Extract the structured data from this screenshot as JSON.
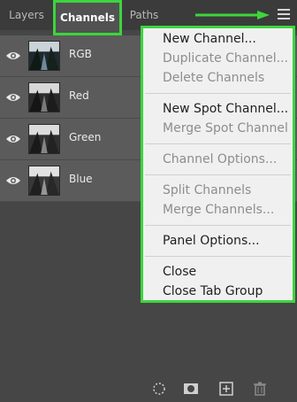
{
  "tabs": {
    "layers": "Layers",
    "channels": "Channels",
    "paths": "Paths"
  },
  "accent_color": "#3dd53d",
  "channels": [
    {
      "label": "RGB"
    },
    {
      "label": "Red"
    },
    {
      "label": "Green"
    },
    {
      "label": "Blue"
    }
  ],
  "menu": {
    "new_channel": "New Channel...",
    "duplicate_channel": "Duplicate Channel...",
    "delete_channels": "Delete Channels",
    "new_spot_channel": "New Spot Channel...",
    "merge_spot_channel": "Merge Spot Channel",
    "channel_options": "Channel Options...",
    "split_channels": "Split Channels",
    "merge_channels": "Merge Channels...",
    "panel_options": "Panel Options...",
    "close": "Close",
    "close_tab_group": "Close Tab Group"
  },
  "toolbar_icons": [
    "load-selection-icon",
    "save-selection-mask-icon",
    "new-channel-icon",
    "trash-icon"
  ]
}
